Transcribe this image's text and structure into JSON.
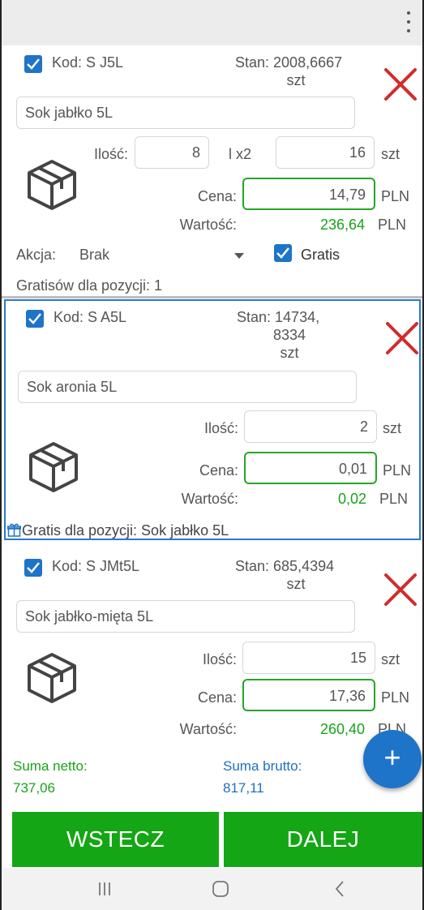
{
  "items": [
    {
      "checked": true,
      "code": "Kod: S J5L",
      "stan_line1": "Stan: 2008,6667",
      "stan_line2": "",
      "stan_unit": "szt",
      "name": "Sok jabłko 5L",
      "qty_label": "Ilość:",
      "qty": "8",
      "multiplier": "l x2",
      "qty_total": "16",
      "unit": "szt",
      "price_label": "Cena:",
      "price": "14,79",
      "currency": "PLN",
      "value_label": "Wartość:",
      "value": "236,64",
      "action_label": "Akcja:",
      "action_value": "Brak",
      "gratis_label": "Gratis",
      "gratis_checked": true,
      "footer": "Gratisów dla pozycji: 1"
    },
    {
      "checked": true,
      "code": "Kod: S A5L",
      "stan_line1": "Stan: 14734,",
      "stan_line2": "8334",
      "stan_unit": "szt",
      "name": "Sok aronia 5L",
      "qty_label": "Ilość:",
      "qty": "2",
      "unit": "szt",
      "price_label": "Cena:",
      "price": "0,01",
      "currency": "PLN",
      "value_label": "Wartość:",
      "value": "0,02",
      "footer": "Gratis dla pozycji: Sok jabłko 5L"
    },
    {
      "checked": true,
      "code": "Kod: S JMt5L",
      "stan_line1": "Stan: 685,4394",
      "stan_line2": "",
      "stan_unit": "szt",
      "name": "Sok jabłko-mięta 5L",
      "qty_label": "Ilość:",
      "qty": "15",
      "unit": "szt",
      "price_label": "Cena:",
      "price": "17,36",
      "currency": "PLN",
      "value_label": "Wartość:",
      "value": "260,40"
    }
  ],
  "totals": {
    "net_label": "Suma netto:",
    "net_value": "737,06",
    "gross_label": "Suma brutto:",
    "gross_value": "817,11"
  },
  "fab_label": "+",
  "buttons": {
    "back": "WSTECZ",
    "next": "DALEJ"
  },
  "colors": {
    "accent_blue": "#1e74c8",
    "green": "#14a614",
    "delete_red": "#d12c2c"
  }
}
